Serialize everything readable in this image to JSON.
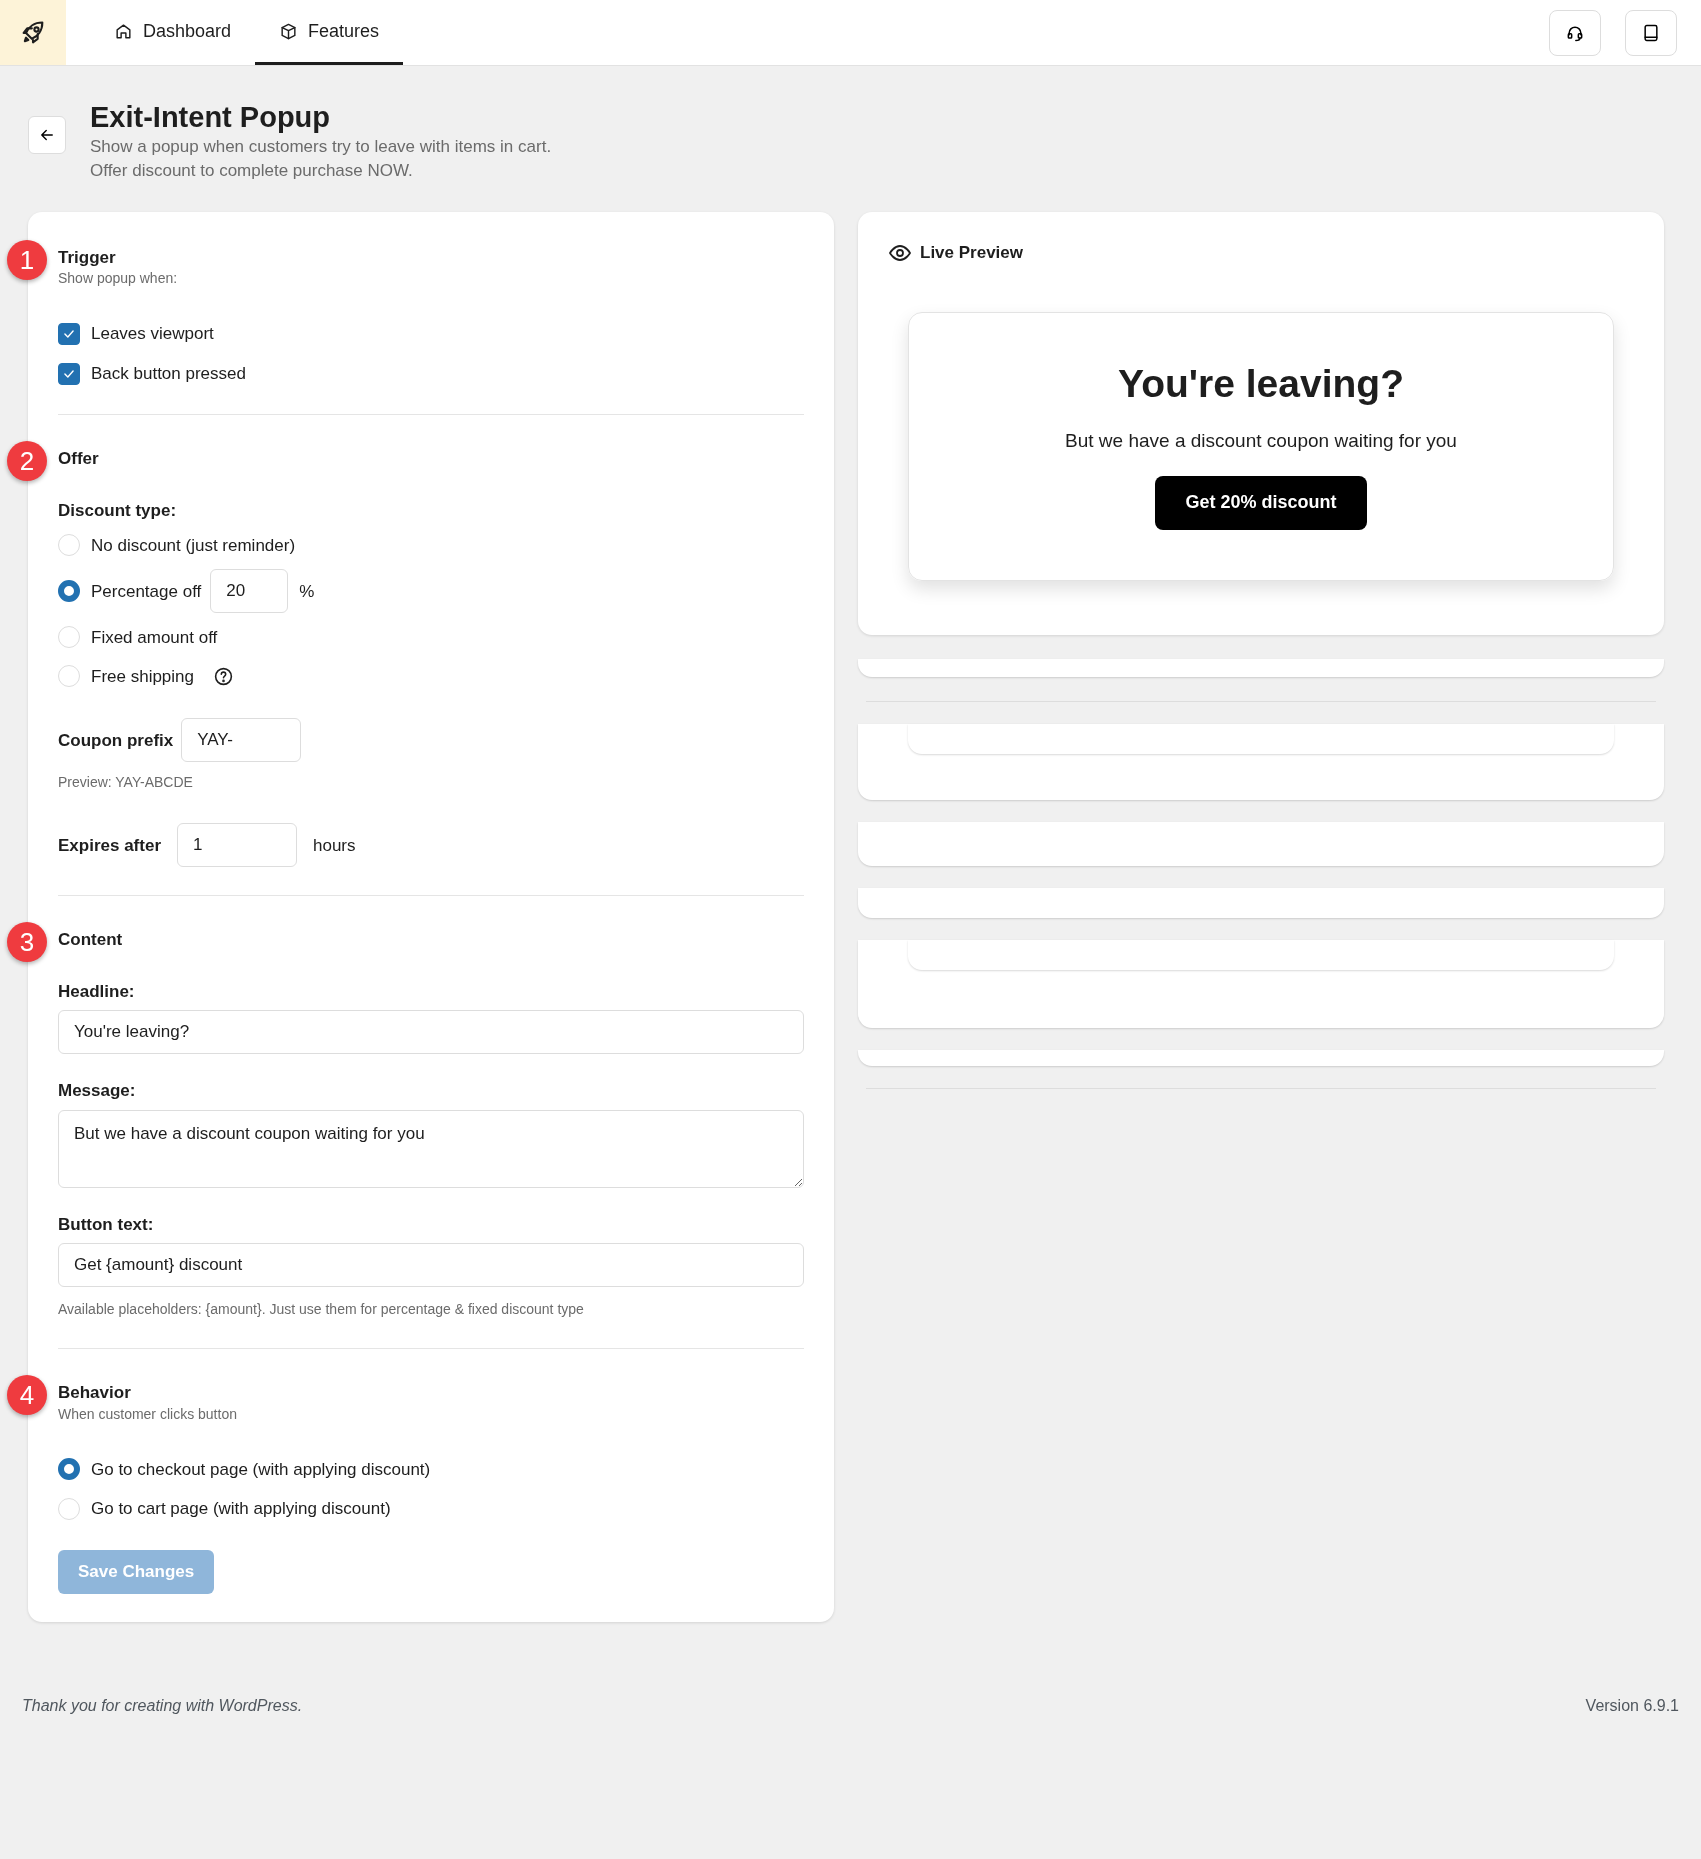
{
  "nav": {
    "tabs": [
      {
        "label": "Dashboard",
        "selected": false
      },
      {
        "label": "Features",
        "selected": true
      }
    ]
  },
  "header": {
    "title": "Exit-Intent Popup",
    "subtitle": [
      "Show a popup when customers try to leave with items in cart.",
      "Offer discount to complete purchase NOW."
    ]
  },
  "sections": [
    {
      "kind": "checkboxes",
      "number": "1",
      "title": "Trigger",
      "subtitle": "Show popup when:",
      "items": [
        {
          "label": "Leaves viewport",
          "checked": true
        },
        {
          "label": "Back button pressed",
          "checked": true
        }
      ]
    },
    {
      "kind": "offer",
      "number": "2",
      "title": "Offer",
      "discount_label": "Discount type:",
      "options": [
        {
          "label": "No discount (just reminder)",
          "selected": false
        },
        {
          "label": "Percentage off",
          "selected": true,
          "value": "20",
          "unit": "%"
        },
        {
          "label": "Fixed amount off",
          "selected": false
        },
        {
          "label": "Free shipping",
          "selected": false,
          "help": true
        }
      ],
      "coupon_prefix": {
        "label": "Coupon prefix",
        "value": "YAY-"
      },
      "coupon_preview": "Preview: YAY-ABCDE",
      "expires": {
        "label": "Expires after",
        "value": "1",
        "unit": "hours"
      }
    },
    {
      "kind": "content",
      "number": "3",
      "title": "Content",
      "fields": [
        {
          "kind": "input",
          "label": "Headline:",
          "value": "You're leaving?"
        },
        {
          "kind": "textarea",
          "label": "Message:",
          "value": "But we have a discount coupon waiting for you"
        },
        {
          "kind": "input",
          "label": "Button text:",
          "value": "Get {amount} discount",
          "hint": "Available placeholders: {amount}. Just use them for percentage & fixed discount type"
        }
      ]
    },
    {
      "kind": "radios",
      "number": "4",
      "title": "Behavior",
      "subtitle": "When customer clicks button",
      "items": [
        {
          "label": "Go to checkout page (with applying discount)",
          "selected": true
        },
        {
          "label": "Go to cart page (with applying discount)",
          "selected": false
        }
      ]
    }
  ],
  "save_button": {
    "label": "Save Changes",
    "disabled": true
  },
  "preview": {
    "title": "Live Preview",
    "headline": "You're leaving?",
    "message": "But we have a discount coupon waiting for you",
    "button": "Get 20% discount"
  },
  "footer": {
    "left": "Thank you for creating with WordPress.",
    "right": "Version 6.9.1"
  }
}
